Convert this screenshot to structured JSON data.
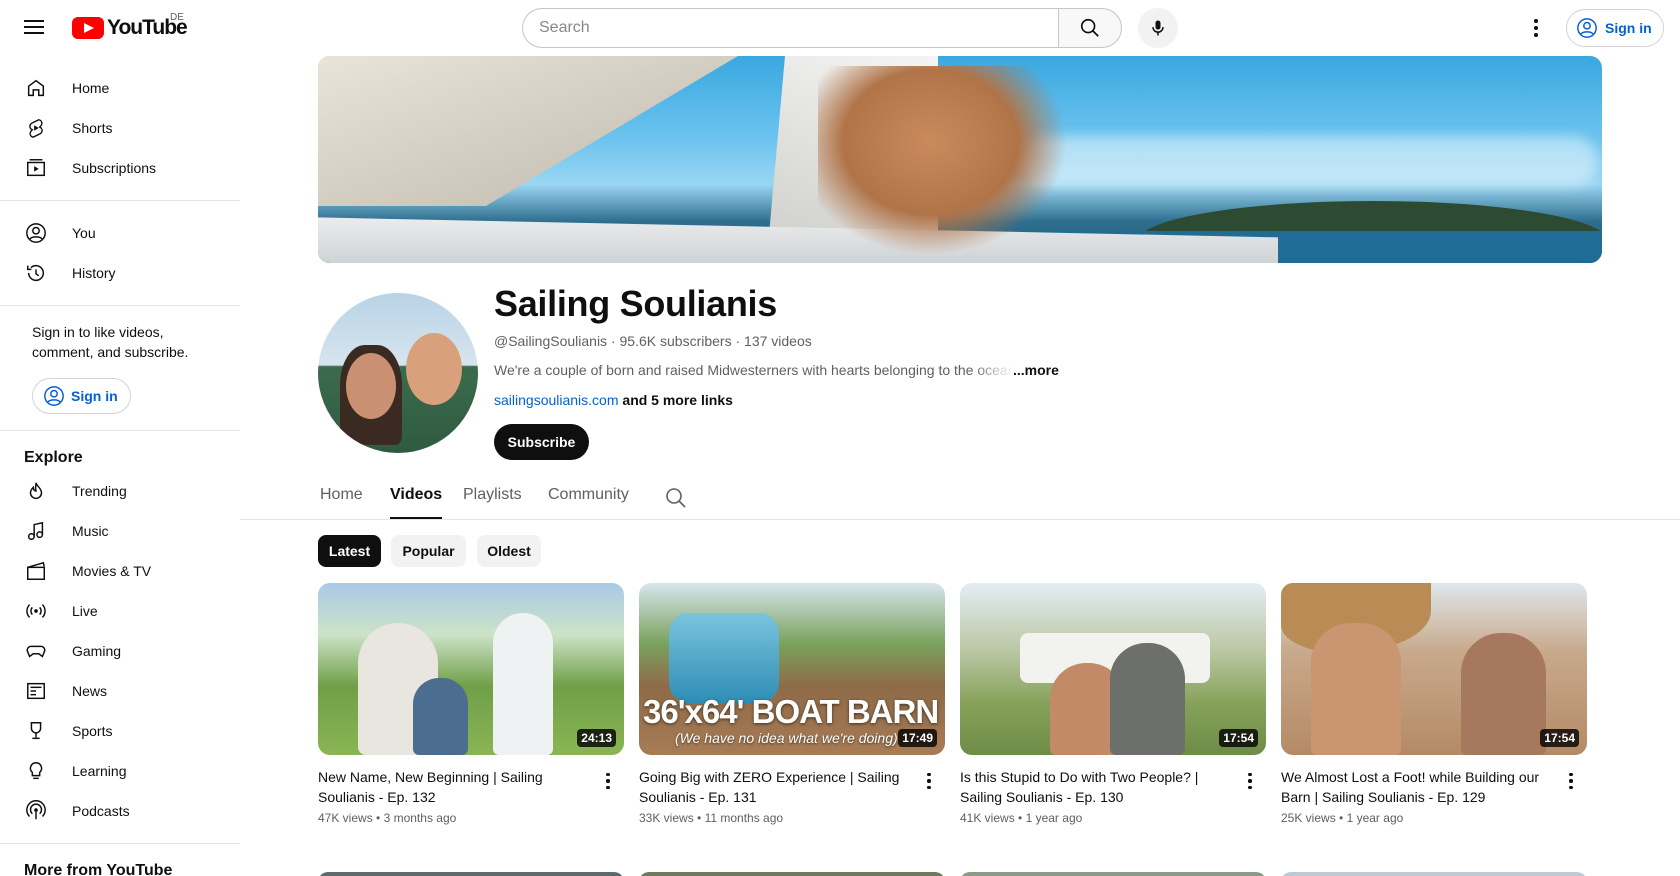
{
  "header": {
    "logo_text": "YouTube",
    "country_code": "DE",
    "search_placeholder": "Search",
    "sign_in": "Sign in"
  },
  "sidebar": {
    "primary": [
      {
        "label": "Home",
        "icon": "home-icon"
      },
      {
        "label": "Shorts",
        "icon": "shorts-icon"
      },
      {
        "label": "Subscriptions",
        "icon": "subscriptions-icon"
      }
    ],
    "secondary": [
      {
        "label": "You",
        "icon": "account-icon"
      },
      {
        "label": "History",
        "icon": "history-icon"
      }
    ],
    "signin_note": "Sign in to like videos, comment, and subscribe.",
    "signin_button": "Sign in",
    "explore_title": "Explore",
    "explore": [
      {
        "label": "Trending",
        "icon": "trending-icon"
      },
      {
        "label": "Music",
        "icon": "music-icon"
      },
      {
        "label": "Movies & TV",
        "icon": "movies-icon"
      },
      {
        "label": "Live",
        "icon": "live-icon"
      },
      {
        "label": "Gaming",
        "icon": "gaming-icon"
      },
      {
        "label": "News",
        "icon": "news-icon"
      },
      {
        "label": "Sports",
        "icon": "sports-icon"
      },
      {
        "label": "Learning",
        "icon": "learning-icon"
      },
      {
        "label": "Podcasts",
        "icon": "podcasts-icon"
      }
    ],
    "more_title": "More from YouTube"
  },
  "channel": {
    "name": "Sailing Soulianis",
    "handle": "@SailingSoulianis",
    "subscribers": "95.6K subscribers",
    "videos_count": "137 videos",
    "description": "We're a couple of born and raised Midwesterners with hearts belonging to the ocean. After",
    "more_label": "...more",
    "link": "sailingsoulianis.com",
    "more_links": "and 5 more links",
    "subscribe_label": "Subscribe"
  },
  "tabs": [
    {
      "label": "Home",
      "active": false
    },
    {
      "label": "Videos",
      "active": true
    },
    {
      "label": "Playlists",
      "active": false
    },
    {
      "label": "Community",
      "active": false
    }
  ],
  "chips": [
    {
      "label": "Latest",
      "active": true
    },
    {
      "label": "Popular",
      "active": false
    },
    {
      "label": "Oldest",
      "active": false
    }
  ],
  "videos": [
    {
      "title": "New Name, New Beginning | Sailing Soulianis - Ep. 132",
      "views": "47K views",
      "age": "3 months ago",
      "duration": "24:13"
    },
    {
      "title": "Going Big with ZERO Experience | Sailing Soulianis - Ep. 131",
      "views": "33K views",
      "age": "11 months ago",
      "duration": "17:49",
      "overlay_text": "36'x64' BOAT BARN",
      "overlay_sub": "(We have no idea what we're doing)"
    },
    {
      "title": "Is this Stupid to Do with Two People? | Sailing Soulianis - Ep. 130",
      "views": "41K views",
      "age": "1 year ago",
      "duration": "17:54"
    },
    {
      "title": "We Almost Lost a Foot! while Building our Barn | Sailing Soulianis - Ep. 129",
      "views": "25K views",
      "age": "1 year ago",
      "duration": "17:54"
    }
  ],
  "colors": {
    "brand_red": "#ff0000",
    "link_blue": "#065fd4",
    "text": "#0f0f0f",
    "muted": "#606060"
  }
}
